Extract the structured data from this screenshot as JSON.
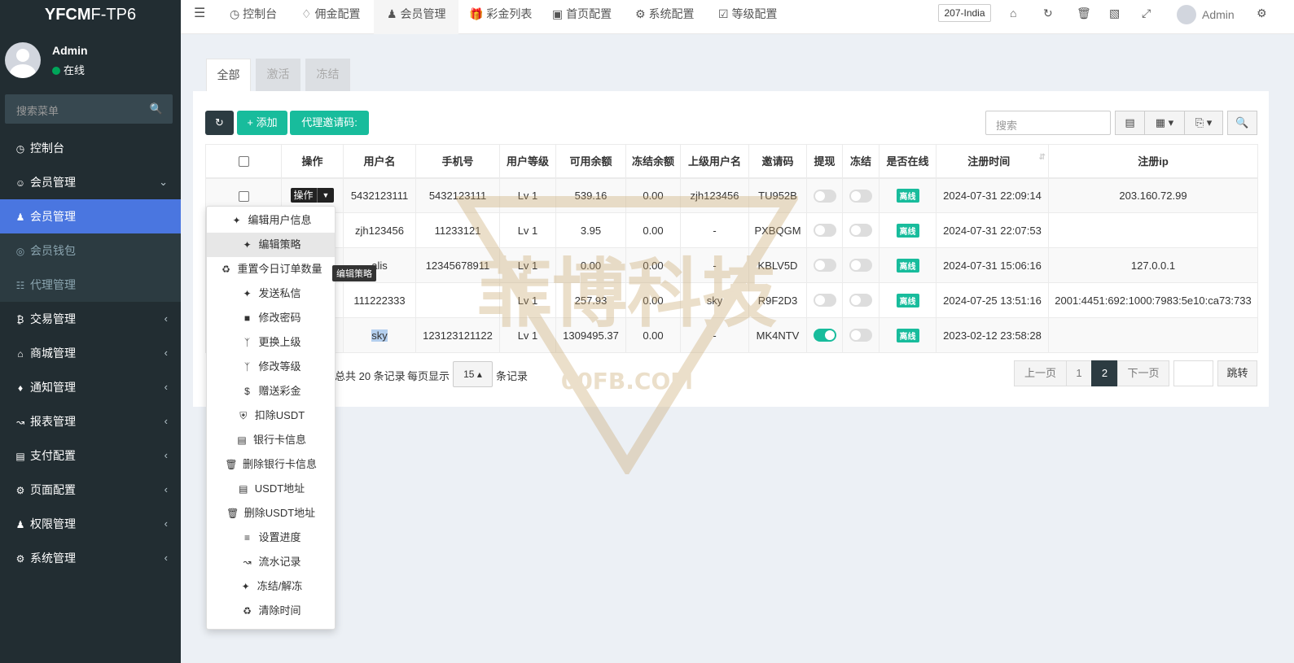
{
  "logo": {
    "bold": "YFCM",
    "light": "F-TP6"
  },
  "user": {
    "name": "Admin",
    "status": "在线"
  },
  "sidebar_search": {
    "placeholder": "搜索菜单"
  },
  "menu": [
    {
      "label": "控制台",
      "icon": "dashboard-icon"
    },
    {
      "label": "会员管理",
      "icon": "user-circle-icon"
    },
    {
      "label": "会员管理",
      "icon": "user-icon"
    },
    {
      "label": "会员钱包",
      "icon": "wallet-icon"
    },
    {
      "label": "代理管理",
      "icon": "sitemap-icon"
    },
    {
      "label": "交易管理",
      "icon": "bitcoin-icon"
    },
    {
      "label": "商城管理",
      "icon": "bank-icon"
    },
    {
      "label": "通知管理",
      "icon": "bell-icon"
    },
    {
      "label": "报表管理",
      "icon": "line-chart-icon"
    },
    {
      "label": "支付配置",
      "icon": "credit-card-icon"
    },
    {
      "label": "页面配置",
      "icon": "gear-icon"
    },
    {
      "label": "权限管理",
      "icon": "users-icon"
    },
    {
      "label": "系统管理",
      "icon": "gears-icon"
    }
  ],
  "topnav": [
    {
      "label": "控制台"
    },
    {
      "label": "佣金配置"
    },
    {
      "label": "会员管理"
    },
    {
      "label": "彩金列表"
    },
    {
      "label": "首页配置"
    },
    {
      "label": "系统配置"
    },
    {
      "label": "等级配置"
    }
  ],
  "top_right": {
    "language": "207-India",
    "admin": "Admin"
  },
  "tabs": [
    {
      "label": "全部"
    },
    {
      "label": "激活"
    },
    {
      "label": "冻结"
    }
  ],
  "toolbar": {
    "add": "+ 添加",
    "invite": "代理邀请码:",
    "search_placeholder": "搜索"
  },
  "table": {
    "headers": [
      "操作",
      "用户名",
      "手机号",
      "用户等级",
      "可用余额",
      "冻结余额",
      "上级用户名",
      "邀请码",
      "提现",
      "冻结",
      "是否在线",
      "注册时间",
      "注册ip"
    ],
    "op_label": "操作",
    "rows": [
      {
        "username": "5432123111",
        "phone": "5432123111",
        "level": "Lv 1",
        "balance": "539.16",
        "frozen": "0.00",
        "parent": "zjh123456",
        "invite": "TU952B",
        "withdraw": false,
        "freeze": false,
        "online": "离线",
        "time": "2024-07-31 22:09:14",
        "ip": "203.160.72.99"
      },
      {
        "username": "zjh123456",
        "phone": "11233121",
        "level": "Lv 1",
        "balance": "3.95",
        "frozen": "0.00",
        "parent": "-",
        "invite": "PXBQGM",
        "withdraw": false,
        "freeze": false,
        "online": "离线",
        "time": "2024-07-31 22:07:53",
        "ip": ""
      },
      {
        "username": "alis",
        "phone": "12345678911",
        "level": "Lv 1",
        "balance": "0.00",
        "frozen": "0.00",
        "parent": "-",
        "invite": "KBLV5D",
        "withdraw": false,
        "freeze": false,
        "online": "离线",
        "time": "2024-07-31 15:06:16",
        "ip": "127.0.0.1"
      },
      {
        "username": "111222333",
        "phone": "",
        "level": "Lv 1",
        "balance": "257.93",
        "frozen": "0.00",
        "parent": "sky",
        "invite": "R9F2D3",
        "withdraw": false,
        "freeze": false,
        "online": "离线",
        "time": "2024-07-25 13:51:16",
        "ip": "2001:4451:692:1000:7983:5e10:ca73:733"
      },
      {
        "username": "sky",
        "phone": "123123121122",
        "level": "Lv 1",
        "balance": "1309495.37",
        "frozen": "0.00",
        "parent": "-",
        "invite": "MK4NTV",
        "withdraw": true,
        "freeze": false,
        "online": "离线",
        "time": "2023-02-12 23:58:28",
        "ip": ""
      }
    ]
  },
  "pager": {
    "total": "总共 20 条记录",
    "per_page_prefix": "每页显示",
    "per_page": "15",
    "per_page_suffix": "条记录",
    "prev": "上一页",
    "p1": "1",
    "p2": "2",
    "next": "下一页",
    "jump": "跳转"
  },
  "dropdown": [
    {
      "label": "编辑用户信息",
      "icon": "magic-icon"
    },
    {
      "label": "编辑策略",
      "icon": "magic-icon"
    },
    {
      "label": "重置今日订单数量",
      "icon": "recycle-icon"
    },
    {
      "label": "发送私信",
      "icon": "magic-icon"
    },
    {
      "label": "修改密码",
      "icon": "lock-icon"
    },
    {
      "label": "更换上级",
      "icon": "git-branch-icon"
    },
    {
      "label": "修改等级",
      "icon": "git-branch-icon"
    },
    {
      "label": "赠送彩金",
      "icon": "dollar-icon"
    },
    {
      "label": "扣除USDT",
      "icon": "shield-icon"
    },
    {
      "label": "银行卡信息",
      "icon": "credit-card-icon"
    },
    {
      "label": "删除银行卡信息",
      "icon": "trash-icon"
    },
    {
      "label": "USDT地址",
      "icon": "credit-card-icon"
    },
    {
      "label": "删除USDT地址",
      "icon": "trash-icon"
    },
    {
      "label": "设置进度",
      "icon": "sliders-icon"
    },
    {
      "label": "流水记录",
      "icon": "line-chart-icon"
    },
    {
      "label": "冻结/解冻",
      "icon": "magic-icon"
    },
    {
      "label": "清除时间",
      "icon": "recycle-icon"
    }
  ],
  "tooltip": "编辑策略",
  "watermark": {
    "text": "菲博科技",
    "sub": "00FB.COM"
  },
  "colors": {
    "sidebar": "#222d32",
    "active_menu": "#4a76e0",
    "accent_green": "#18bc9c",
    "dark_button": "#2c3b41"
  }
}
